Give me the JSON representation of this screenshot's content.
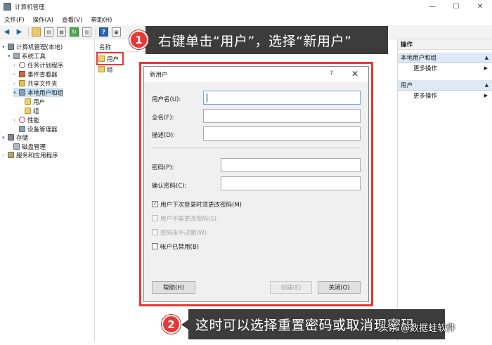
{
  "window": {
    "title": "计算机管理",
    "controls": {
      "minimize": "—",
      "maximize": "☐",
      "close": "✕"
    }
  },
  "menu": [
    "文件(F)",
    "操作(A)",
    "查看(V)",
    "帮助(H)"
  ],
  "toolbar": {
    "help_label": "?"
  },
  "tree": {
    "root": "计算机管理(本地)",
    "system_tools": "系统工具",
    "task_scheduler": "任务计划程序",
    "event_viewer": "事件查看器",
    "shared_folders": "共享文件夹",
    "local_users": "本地用户和组",
    "users": "用户",
    "groups": "组",
    "performance": "性能",
    "device_manager": "设备管理器",
    "storage": "存储",
    "disk_management": "磁盘管理",
    "services": "服务和应用程序"
  },
  "center": {
    "column_name": "名称",
    "items": [
      "用户",
      "组"
    ]
  },
  "actions": {
    "header": "操作",
    "section1": "本地用户和组",
    "section1_more": "更多操作",
    "section2": "用户",
    "section2_more": "更多操作"
  },
  "callout1": {
    "number": "1",
    "text": "右键单击“用户”，选择“新用户”"
  },
  "callout2": {
    "number": "2",
    "text": "这时可以选择重置密码或取消现密码"
  },
  "dialog": {
    "title": "新用户",
    "help_glyph": "?",
    "close_glyph": "✕",
    "username_label": "用户名(U):",
    "username_value": "",
    "fullname_label": "全名(F):",
    "fullname_value": "",
    "description_label": "描述(D):",
    "description_value": "",
    "password_label": "密码(P):",
    "confirm_label": "确认密码(C):",
    "check1": "用户下次登录时须更改密码(M)",
    "check1_checked": true,
    "check2": "用户不能更改密码(S)",
    "check3": "密码永不过期(W)",
    "check4": "帐户已禁用(B)",
    "help_button": "帮助(H)",
    "create_button": "创建(E)",
    "close_button": "关闭(O)"
  },
  "watermark": "头条 @数据蛙软件"
}
